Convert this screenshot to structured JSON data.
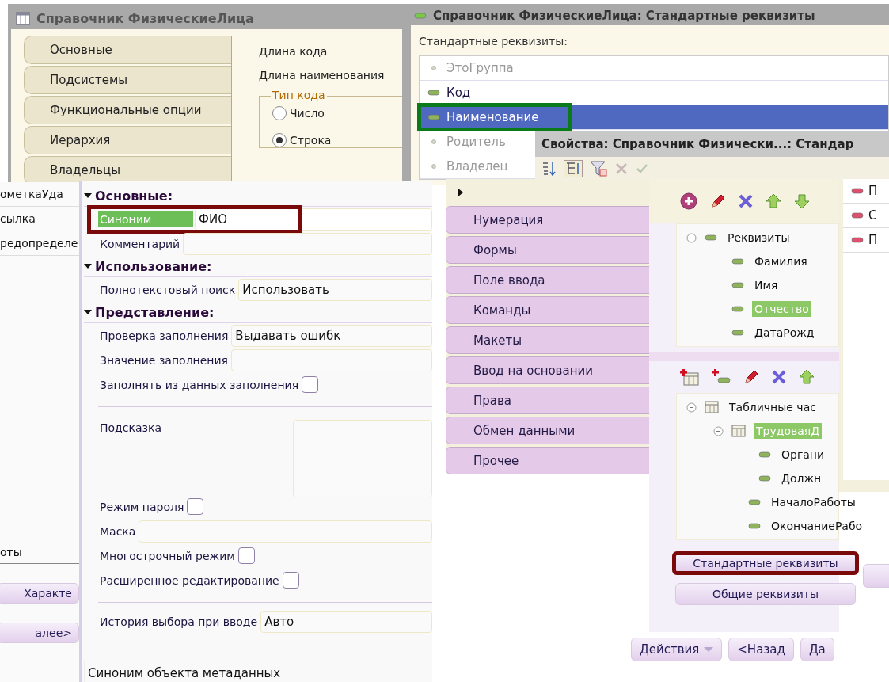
{
  "catalog_window": {
    "title": "Справочник ФизическиеЛица",
    "tabs": [
      "Основные",
      "Подсистемы",
      "Функциональные опции",
      "Иерархия",
      "Владельцы"
    ],
    "fields": [
      "Длина кода",
      "Длина наименования"
    ],
    "code_type": {
      "legend": "Тип кода",
      "options": [
        {
          "label": "Число",
          "selected": false
        },
        {
          "label": "Строка",
          "selected": true
        }
      ]
    }
  },
  "standard_window": {
    "title": "Справочник ФизическиеЛица: Стандартные реквизиты",
    "heading": "Стандартные реквизиты:",
    "items": [
      {
        "label": "ЭтоГруппа",
        "disabled": true,
        "selected": false,
        "highlighted": false
      },
      {
        "label": "Код",
        "disabled": false,
        "selected": false,
        "highlighted": false
      },
      {
        "label": "Наименование",
        "disabled": false,
        "selected": true,
        "highlighted": true
      },
      {
        "label": "Родитель",
        "disabled": true,
        "selected": false,
        "highlighted": false
      },
      {
        "label": "Владелец",
        "disabled": true,
        "selected": false,
        "highlighted": false
      }
    ]
  },
  "properties_title": "Свойства: Справочник Физически...: Стандар",
  "background_list": {
    "items": [
      "ометкаУда",
      "сылка",
      "редопределе"
    ],
    "label": "оты",
    "buttons": [
      "Характе",
      "алее>"
    ]
  },
  "properties_panel": {
    "sections": [
      {
        "title": "Основные:",
        "expanded": true,
        "rows": [
          {
            "kind": "field",
            "label": "Синоним",
            "value": "ФИО",
            "highlighted": true
          },
          {
            "kind": "field",
            "label": "Комментарий",
            "value": "",
            "highlighted": false
          }
        ]
      },
      {
        "title": "Использование:",
        "expanded": true,
        "rows": [
          {
            "kind": "field",
            "label": "Полнотекстовый поиск",
            "value": "Использовать",
            "highlighted": false
          }
        ]
      },
      {
        "title": "Представление:",
        "expanded": true,
        "rows": [
          {
            "kind": "field",
            "label": "Проверка заполнения",
            "value": "Выдавать ошибк",
            "highlighted": false
          },
          {
            "kind": "field",
            "label": "Значение заполнения",
            "value": "",
            "highlighted": false
          },
          {
            "kind": "checkbox",
            "label": "Заполнять из данных заполнения",
            "checked": false
          },
          {
            "kind": "divider"
          },
          {
            "kind": "textarea",
            "label": "Подсказка"
          },
          {
            "kind": "checkbox",
            "label": "Режим пароля",
            "checked": false
          },
          {
            "kind": "field",
            "label": "Маска",
            "value": "",
            "highlighted": false
          },
          {
            "kind": "checkbox",
            "label": "Многострочный режим",
            "checked": false
          },
          {
            "kind": "checkbox",
            "label": "Расширенное редактирование",
            "checked": false
          },
          {
            "kind": "divider"
          },
          {
            "kind": "field",
            "label": "История выбора при вводе",
            "value": "Авто",
            "highlighted": false
          }
        ]
      }
    ],
    "status": "Синоним объекта метаданных"
  },
  "tabs_window": {
    "tabs": [
      "Нумерация",
      "Формы",
      "Поле ввода",
      "Команды",
      "Макеты",
      "Ввод на основании",
      "Права",
      "Обмен данными",
      "Прочее"
    ]
  },
  "tree_panel": {
    "attributes": {
      "label": "Реквизиты",
      "expanded": true,
      "children": [
        {
          "label": "Фамилия",
          "selected": false
        },
        {
          "label": "Имя",
          "selected": false
        },
        {
          "label": "Отчество",
          "selected": true
        },
        {
          "label": "ДатаРожд",
          "selected": false
        }
      ]
    },
    "tabular": {
      "label": "Табличные час",
      "expanded": true,
      "children": [
        {
          "label": "ТрудоваяД",
          "selected": true,
          "expanded": true,
          "children": [
            {
              "label": "Органи",
              "selected": false
            },
            {
              "label": "Должн",
              "selected": false
            },
            {
              "label": "НачалоРаботы",
              "selected": false
            },
            {
              "label": "ОкончаниеРабо",
              "selected": false
            }
          ]
        }
      ]
    },
    "buttons": [
      {
        "label": "Стандартные реквизиты",
        "highlighted": true
      },
      {
        "label": "Общие реквизиты",
        "highlighted": false
      }
    ]
  },
  "bottom_buttons": [
    {
      "label": "Действия",
      "kind": "dropdown"
    },
    {
      "label": "<Назад",
      "kind": "plain"
    },
    {
      "label": "Да",
      "kind": "plain"
    }
  ],
  "right_list": [
    "П",
    "С",
    "П"
  ]
}
